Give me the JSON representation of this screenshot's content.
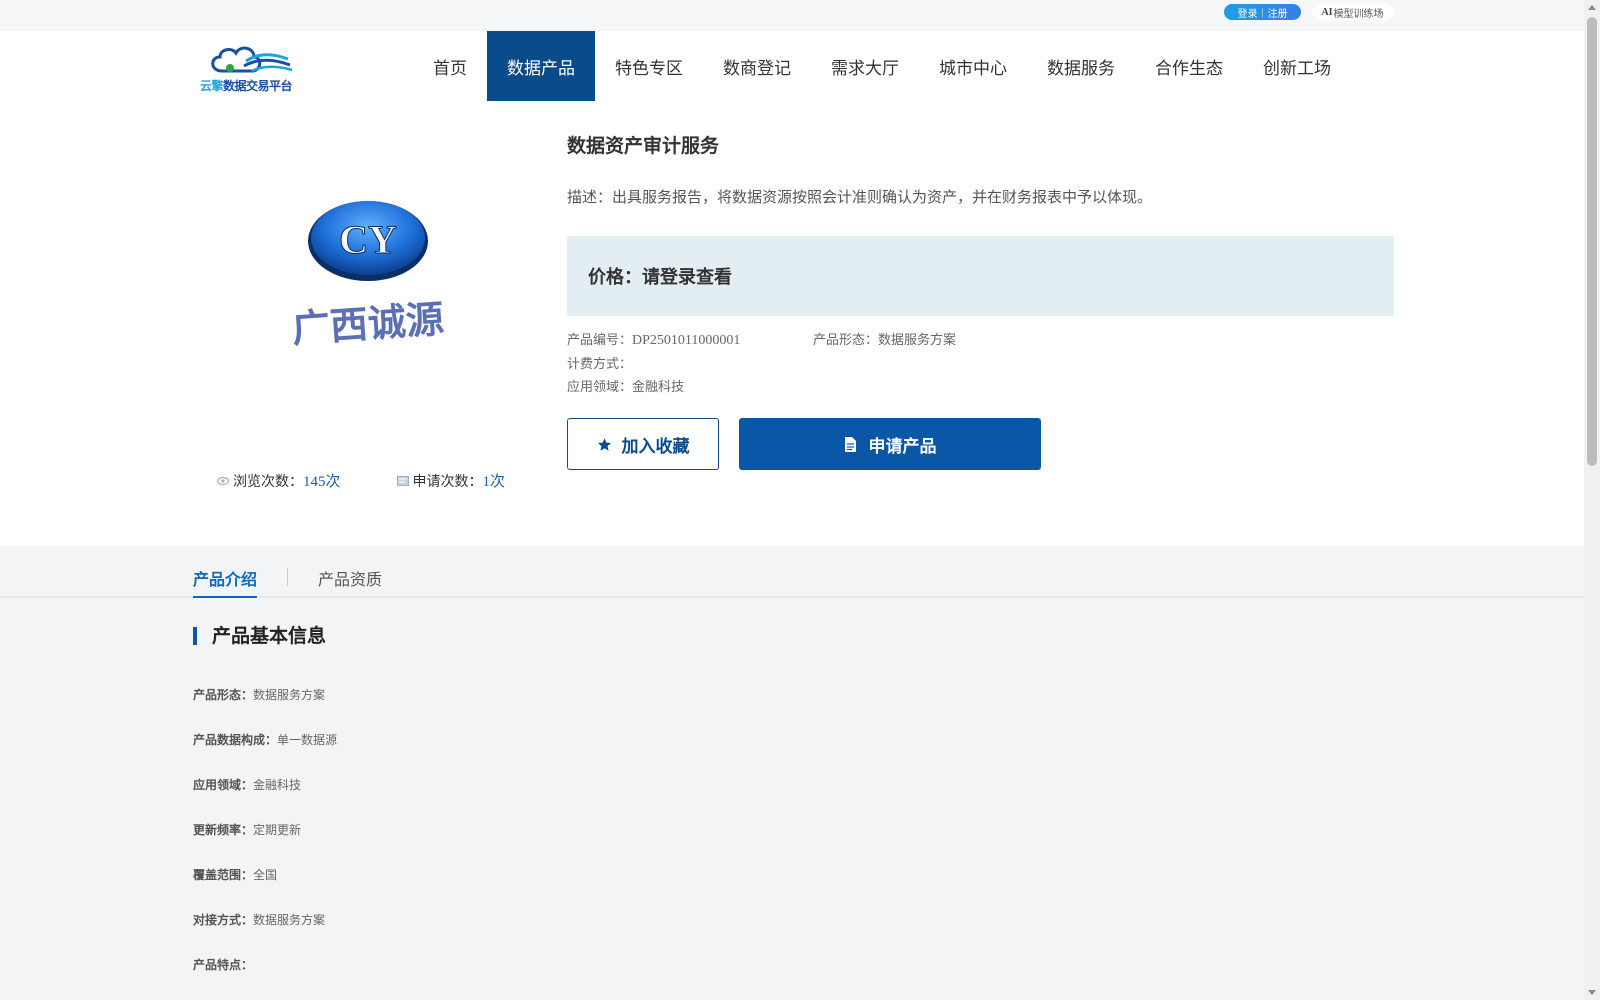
{
  "topbar": {
    "login": "登录",
    "separator": "|",
    "register": "注册",
    "ai_prefix": "AI",
    "ai_label": "模型训练场"
  },
  "logo": {
    "text_a": "云擎",
    "text_b": "数据交易平台"
  },
  "nav": {
    "items": [
      "首页",
      "数据产品",
      "特色专区",
      "数商登记",
      "需求大厅",
      "城市中心",
      "数据服务",
      "合作生态",
      "创新工场"
    ],
    "active_index": 1
  },
  "product": {
    "title": "数据资产审计服务",
    "description": "描述：出具服务报告，将数据资源按照会计准则确认为资产，并在财务报表中予以体现。",
    "price": "价格：请登录查看",
    "code_label": "产品编号：",
    "code_value": "DP2501011000001",
    "form_label": "产品形态：",
    "form_value": "数据服务方案",
    "billing_label": "计费方式：",
    "billing_value": "",
    "domain_label": "应用领域：",
    "domain_value": "金融科技",
    "favorite_button": "加入收藏",
    "apply_button": "申请产品"
  },
  "company_logo": {
    "monogram": "CY",
    "name": "广西诚源"
  },
  "stats": {
    "views_label": "浏览次数：",
    "views_value": "145次",
    "applies_label": "申请次数：",
    "applies_value": "1次"
  },
  "tabs": {
    "intro": "产品介绍",
    "qualification": "产品资质"
  },
  "basic_info": {
    "title": "产品基本信息",
    "rows": [
      {
        "key": "产品形态：",
        "value": "数据服务方案"
      },
      {
        "key": "产品数据构成：",
        "value": "单一数据源"
      },
      {
        "key": "应用领域：",
        "value": "金融科技"
      },
      {
        "key": "更新频率：",
        "value": "定期更新"
      },
      {
        "key": "覆盖范围：",
        "value": "全国"
      },
      {
        "key": "对接方式：",
        "value": "数据服务方案"
      },
      {
        "key": "产品特点：",
        "value": ""
      }
    ]
  },
  "colors": {
    "primary": "#0a4b8c",
    "button": "#0a57a8",
    "price_bg": "#e2eef2",
    "tab_active": "#0a6bc4"
  }
}
